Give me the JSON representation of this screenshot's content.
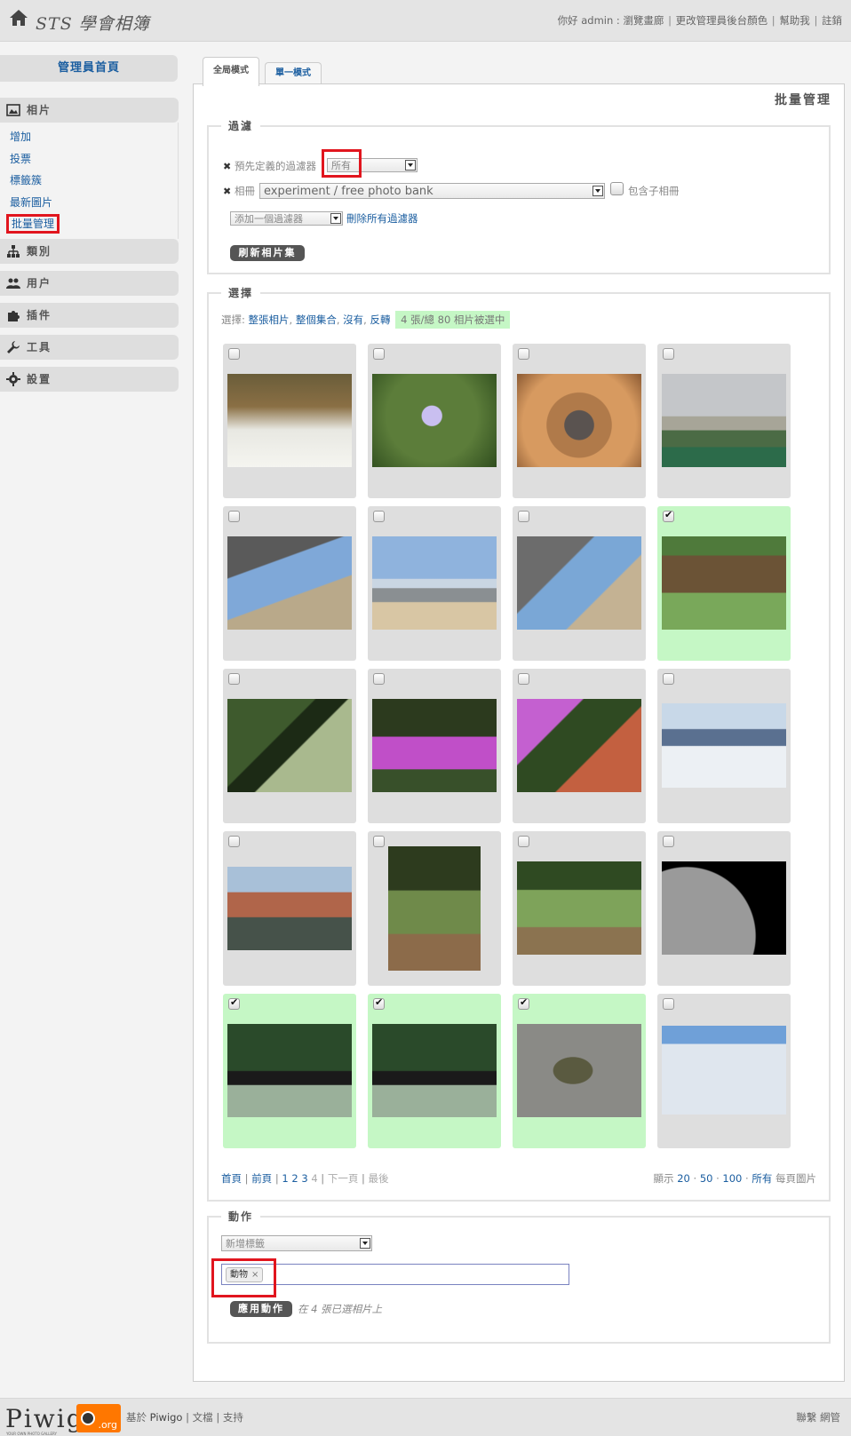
{
  "header": {
    "site_title": "STS 學會相簿",
    "greeting": "你好 admin :",
    "links": [
      "瀏覽畫廊",
      "更改管理員後台顏色",
      "幫助我",
      "註銷"
    ]
  },
  "sidebar": {
    "home": "管理員首頁",
    "sections": [
      {
        "label": "相片",
        "icon": "image-icon"
      },
      {
        "label": "類別",
        "icon": "sitemap-icon"
      },
      {
        "label": "用户",
        "icon": "users-icon"
      },
      {
        "label": "插件",
        "icon": "puzzle-icon"
      },
      {
        "label": "工具",
        "icon": "wrench-icon"
      },
      {
        "label": "設置",
        "icon": "gear-icon"
      }
    ],
    "photo_items": [
      "增加",
      "投票",
      "標籤簇",
      "最新圖片",
      "批量管理"
    ]
  },
  "tabs": [
    "全局模式",
    "單一模式"
  ],
  "page_title": "批量管理",
  "filter": {
    "legend": "過濾",
    "predefined_label": "預先定義的過濾器",
    "predefined_value": "所有",
    "album_label": "相冊",
    "album_value": "experiment / free photo bank",
    "include_sub": "包含子相冊",
    "add_filter": "添加一個過濾器",
    "remove_all": "刪除所有過濾器",
    "refresh": "刷新相片集"
  },
  "selection": {
    "legend": "選擇",
    "prefix": "選擇:",
    "whole_page": "整張相片",
    "whole_set": "整個集合",
    "none": "沒有",
    "invert": "反轉",
    "count": "4 張/總 80 相片被選中",
    "checked": [
      false,
      false,
      false,
      false,
      false,
      false,
      false,
      true,
      false,
      false,
      false,
      false,
      false,
      false,
      false,
      false,
      true,
      true,
      true,
      false
    ],
    "pager": {
      "first": "首頁",
      "prev": "前頁",
      "pages": [
        "1",
        "2",
        "3"
      ],
      "current": "4",
      "next": "下一頁",
      "last": "最後"
    },
    "per_page": {
      "label": "顯示",
      "options": [
        "20",
        "50",
        "100",
        "所有"
      ],
      "suffix": "每頁圖片"
    }
  },
  "action": {
    "legend": "動作",
    "select_value": "新增標籤",
    "tag": "動物",
    "tag_remove": "×",
    "apply": "應用動作",
    "note": "在 4 張已選相片上"
  },
  "footer": {
    "logo": "Piwigo",
    "logo_org": ".org",
    "logo_sub": "YOUR OWN PHOTO GALLERY",
    "based_on": "基於",
    "piwigo": "Piwigo",
    "docs": "文檔",
    "support": "支持",
    "contact": "聯繫 網管"
  }
}
